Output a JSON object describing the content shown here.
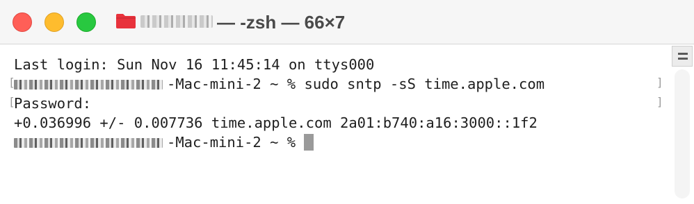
{
  "window": {
    "title": "— -zsh — 66×7"
  },
  "terminal": {
    "lines": [
      "Last login: Sun Nov 16 11:45:14 on ttys000",
      "-Mac-mini-2 ~ % sudo sntp -sS time.apple.com",
      "Password:",
      "+0.036996 +/- 0.007736 time.apple.com 2a01:b740:a16:3000::1f2",
      "-Mac-mini-2 ~ % "
    ]
  },
  "colors": {
    "close": "#ff5f57",
    "minimize": "#febc2e",
    "maximize": "#28c840",
    "folder": "#e8323c",
    "cursor": "#9a9a9a"
  }
}
